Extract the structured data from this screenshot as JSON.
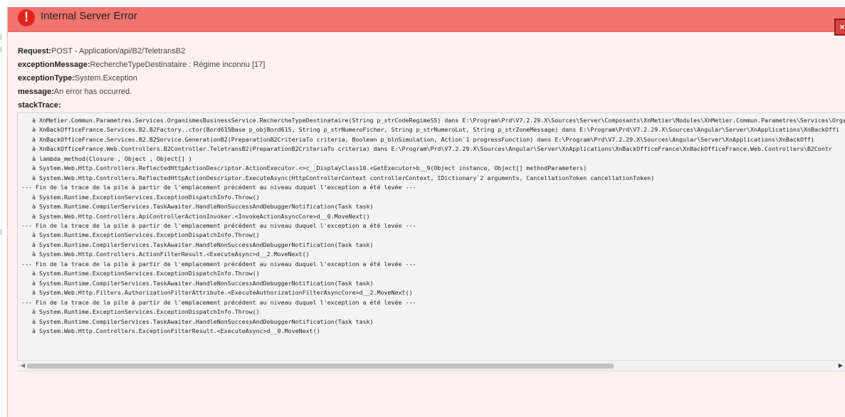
{
  "header": {
    "icon": "exclamation-icon",
    "icon_glyph": "!",
    "title": "Internal Server Error",
    "close_glyph": "×",
    "color": "#f1736f"
  },
  "fields": [
    {
      "label": "Request:",
      "value": "POST - Application/api/B2/TeletransB2"
    },
    {
      "label": "exceptionMessage:",
      "value": "RechercheTypeDestinataire : Régime inconnu [17]"
    },
    {
      "label": "exceptionType:",
      "value": "System.Exception"
    },
    {
      "label": "message:",
      "value": "An error has occurred."
    },
    {
      "label": "stackTrace:",
      "value": ""
    }
  ],
  "stack_trace": [
    "   à XnMetier.Commun.Parametres.Services.OrganismesBusinessService.RechercheTypeDestinataire(String p_strCodeRegimeSS) dans E:\\Program\\Prd\\V7.2.29.X\\Sources\\Server\\Composants\\XnMetier\\Modules\\XnMetier.Commun.Parametres\\Services\\Organis",
    "   à XnBackOfficeFrance.Services.B2.B2Factory..ctor(Bord615Base p_objBord615, String p_strNumeroFicher, String p_strNumeroLot, String p_strZoneMessage) dans E:\\Program\\Prd\\V7.2.29.X\\Sources\\Angular\\Server\\XnApplications\\XnBackOffi",
    "   à XnBackOfficeFrance.Services.B2.B2Service.GenerationB2(PreparationB2CriteriaTo criteria, Boolean p_blnSimulation, Action`1 progressFunction) dans E:\\Program\\Prd\\V7.2.29.X\\Sources\\Angular\\Server\\XnApplications\\XnBackOffi",
    "   à XnBackOfficeFrance.Web.Controllers.B2Controller.TeletransB2(PreparationB2CriteriaTo criteria) dans E:\\Program\\Prd\\V7.2.29.X\\Sources\\Angular\\Server\\XnApplications\\XnBackOfficeFrance\\XnBackOfficeFrance.Web.Controllers\\B2Contr",
    "   à lambda_method(Closure , Object , Object[] )",
    "   à System.Web.Http.Controllers.ReflectedHttpActionDescriptor.ActionExecutor.<>c__DisplayClass10.<GetExecutor>b__9(Object instance, Object[] methodParameters)",
    "   à System.Web.Http.Controllers.ReflectedHttpActionDescriptor.ExecuteAsync(HttpControllerContext controllerContext, IDictionary`2 arguments, CancellationToken cancellationToken)",
    "--- Fin de la trace de la pile à partir de l'emplacement précédent au niveau duquel l'exception a été levée ---",
    "   à System.Runtime.ExceptionServices.ExceptionDispatchInfo.Throw()",
    "   à System.Runtime.CompilerServices.TaskAwaiter.HandleNonSuccessAndDebuggerNotification(Task task)",
    "   à System.Web.Http.Controllers.ApiControllerActionInvoker.<InvokeActionAsyncCore>d__0.MoveNext()",
    "--- Fin de la trace de la pile à partir de l'emplacement précédent au niveau duquel l'exception a été levée ---",
    "   à System.Runtime.ExceptionServices.ExceptionDispatchInfo.Throw()",
    "   à System.Runtime.CompilerServices.TaskAwaiter.HandleNonSuccessAndDebuggerNotification(Task task)",
    "   à System.Web.Http.Controllers.ActionFilterResult.<ExecuteAsync>d__2.MoveNext()",
    "--- Fin de la trace de la pile à partir de l'emplacement précédent au niveau duquel l'exception a été levée ---",
    "   à System.Runtime.ExceptionServices.ExceptionDispatchInfo.Throw()",
    "   à System.Runtime.CompilerServices.TaskAwaiter.HandleNonSuccessAndDebuggerNotification(Task task)",
    "   à System.Web.Http.Filters.AuthorizationFilterAttribute.<ExecuteAuthorizationFilterAsyncCore>d__2.MoveNext()",
    "--- Fin de la trace de la pile à partir de l'emplacement précédent au niveau duquel l'exception a été levée ---",
    "   à System.Runtime.ExceptionServices.ExceptionDispatchInfo.Throw()",
    "   à System.Runtime.CompilerServices.TaskAwaiter.HandleNonSuccessAndDebuggerNotification(Task task)",
    "   à System.Web.Http.Controllers.ExceptionFilterResult.<ExecuteAsync>d__0.MoveNext()"
  ],
  "scrollbar": {
    "left_arrow": "◀",
    "right_arrow": "▶"
  }
}
